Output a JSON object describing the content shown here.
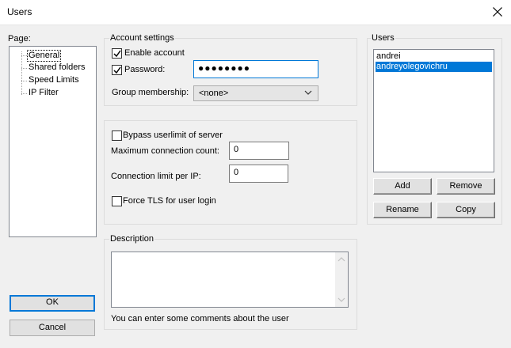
{
  "window": {
    "title": "Users"
  },
  "page_panel": {
    "label": "Page:",
    "items": [
      "General",
      "Shared folders",
      "Speed Limits",
      "IP Filter"
    ],
    "selected": "General"
  },
  "account": {
    "legend": "Account settings",
    "enable_account_label": "Enable account",
    "enable_account_checked": true,
    "password_label": "Password:",
    "password_checked": true,
    "password_masked": "●●●●●●●●",
    "group_label": "Group membership:",
    "group_value": "<none>"
  },
  "limits": {
    "bypass_label": "Bypass userlimit of server",
    "bypass_checked": false,
    "max_conn_label": "Maximum connection count:",
    "max_conn_value": "0",
    "per_ip_label": "Connection limit per IP:",
    "per_ip_value": "0",
    "force_tls_label": "Force TLS for user login",
    "force_tls_checked": false
  },
  "description": {
    "legend": "Description",
    "hint": "You can enter some comments about the user"
  },
  "users": {
    "legend": "Users",
    "list": [
      "andrei",
      "andreyolegovichru"
    ],
    "selected_index": 1,
    "add_label": "Add",
    "remove_label": "Remove",
    "rename_label": "Rename",
    "copy_label": "Copy"
  },
  "footer": {
    "ok_label": "OK",
    "cancel_label": "Cancel"
  },
  "colors": {
    "accent": "#0078d7",
    "background": "#f0f0f0"
  }
}
